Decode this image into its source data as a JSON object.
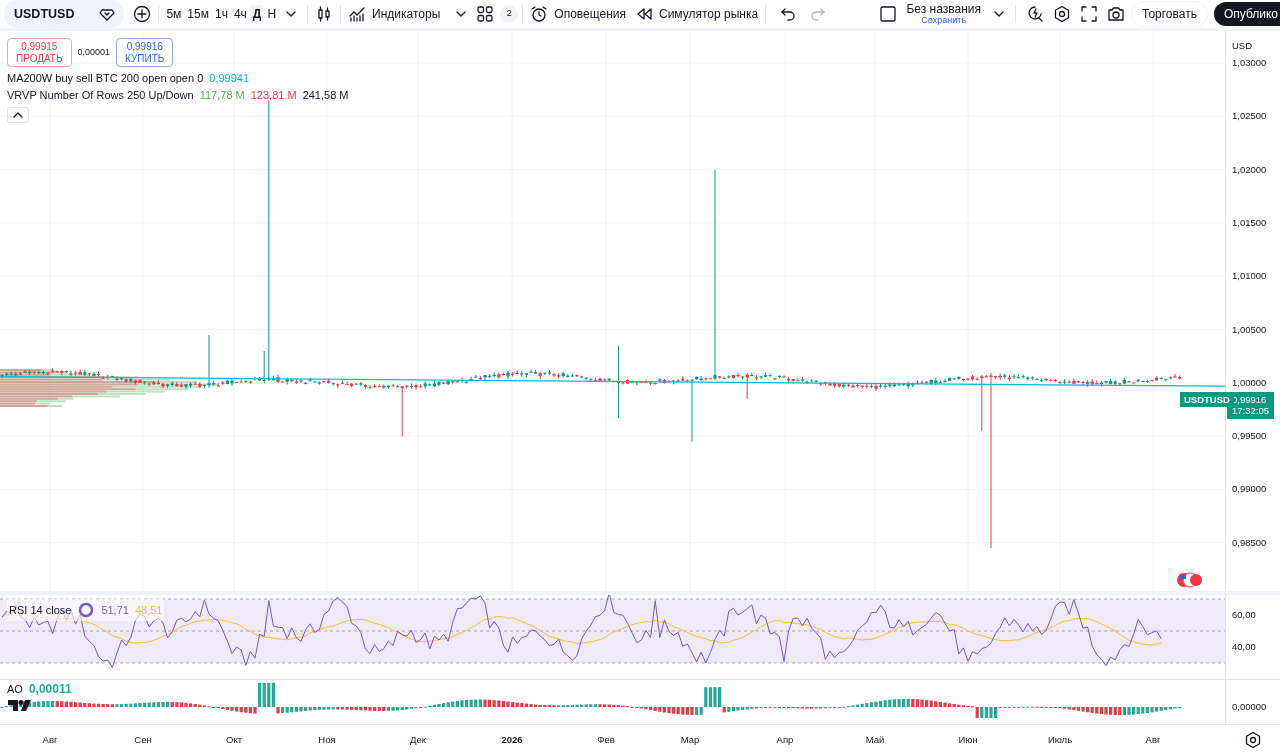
{
  "toolbar": {
    "symbol": "USDTUSD",
    "intervals": [
      {
        "label": "5м",
        "selected": false
      },
      {
        "label": "15м",
        "selected": false
      },
      {
        "label": "1ч",
        "selected": false
      },
      {
        "label": "4ч",
        "selected": false
      },
      {
        "label": "Д",
        "selected": true
      },
      {
        "label": "Н",
        "selected": false
      }
    ],
    "indicators_label": "Индикаторы",
    "layouts_count": "2",
    "alerts_label": "Оповещения",
    "replay_label": "Симулятор рынка",
    "layout_name": "Без названия",
    "save_label": "Сохранить",
    "trade_button": "Торговать",
    "publish_button": "Опублико"
  },
  "price_pane": {
    "sell": {
      "price": "0,99915",
      "label": "ПРОДАТЬ"
    },
    "spread": "0,00001",
    "buy": {
      "price": "0,99916",
      "label": "КУПИТЬ"
    },
    "studies": [
      {
        "title": "MA200W buy sell BTC 200 open open 0",
        "values": [
          {
            "text": "0,99941",
            "color": "#00bcd4"
          }
        ]
      },
      {
        "title": "VRVP Number Of Rows 250 Up/Down",
        "values": [
          {
            "text": "117,78 M",
            "color": "#4caf50"
          },
          {
            "text": "123,81 M",
            "color": "#f23645"
          },
          {
            "text": "241,58 M",
            "color": "#131722"
          }
        ]
      }
    ],
    "axis": {
      "currency": "USD",
      "ticks": [
        "1,03000",
        "1,02500",
        "1,02000",
        "1,01500",
        "1,01000",
        "1,00500",
        "1,00000",
        "0,99500",
        "0,99000",
        "0,98500"
      ]
    },
    "last_price": {
      "symbol": "USDTUSD",
      "price": "0,99916",
      "countdown": "17:32:05"
    }
  },
  "rsi_pane": {
    "title": "RSI 14 close",
    "values": [
      {
        "text": "51,71",
        "color": "#7e57c2"
      },
      {
        "text": "48,51",
        "color": "#fbc02d"
      }
    ],
    "axis": [
      "60,00",
      "40,00"
    ]
  },
  "ao_pane": {
    "title": "AO",
    "values": [
      {
        "text": "0,00011",
        "color": "#22ab94"
      }
    ],
    "axis": [
      "0,00000"
    ]
  },
  "time_axis": [
    {
      "label": "Авг",
      "bold": false
    },
    {
      "label": "Сен",
      "bold": false
    },
    {
      "label": "Окт",
      "bold": false
    },
    {
      "label": "Ноя",
      "bold": false
    },
    {
      "label": "Дек",
      "bold": false
    },
    {
      "label": "2026",
      "bold": true
    },
    {
      "label": "Фев",
      "bold": false
    },
    {
      "label": "Мар",
      "bold": false
    },
    {
      "label": "Апр",
      "bold": false
    },
    {
      "label": "Май",
      "bold": false
    },
    {
      "label": "Июн",
      "bold": false
    },
    {
      "label": "Июль",
      "bold": false
    },
    {
      "label": "Авг",
      "bold": false
    }
  ]
}
